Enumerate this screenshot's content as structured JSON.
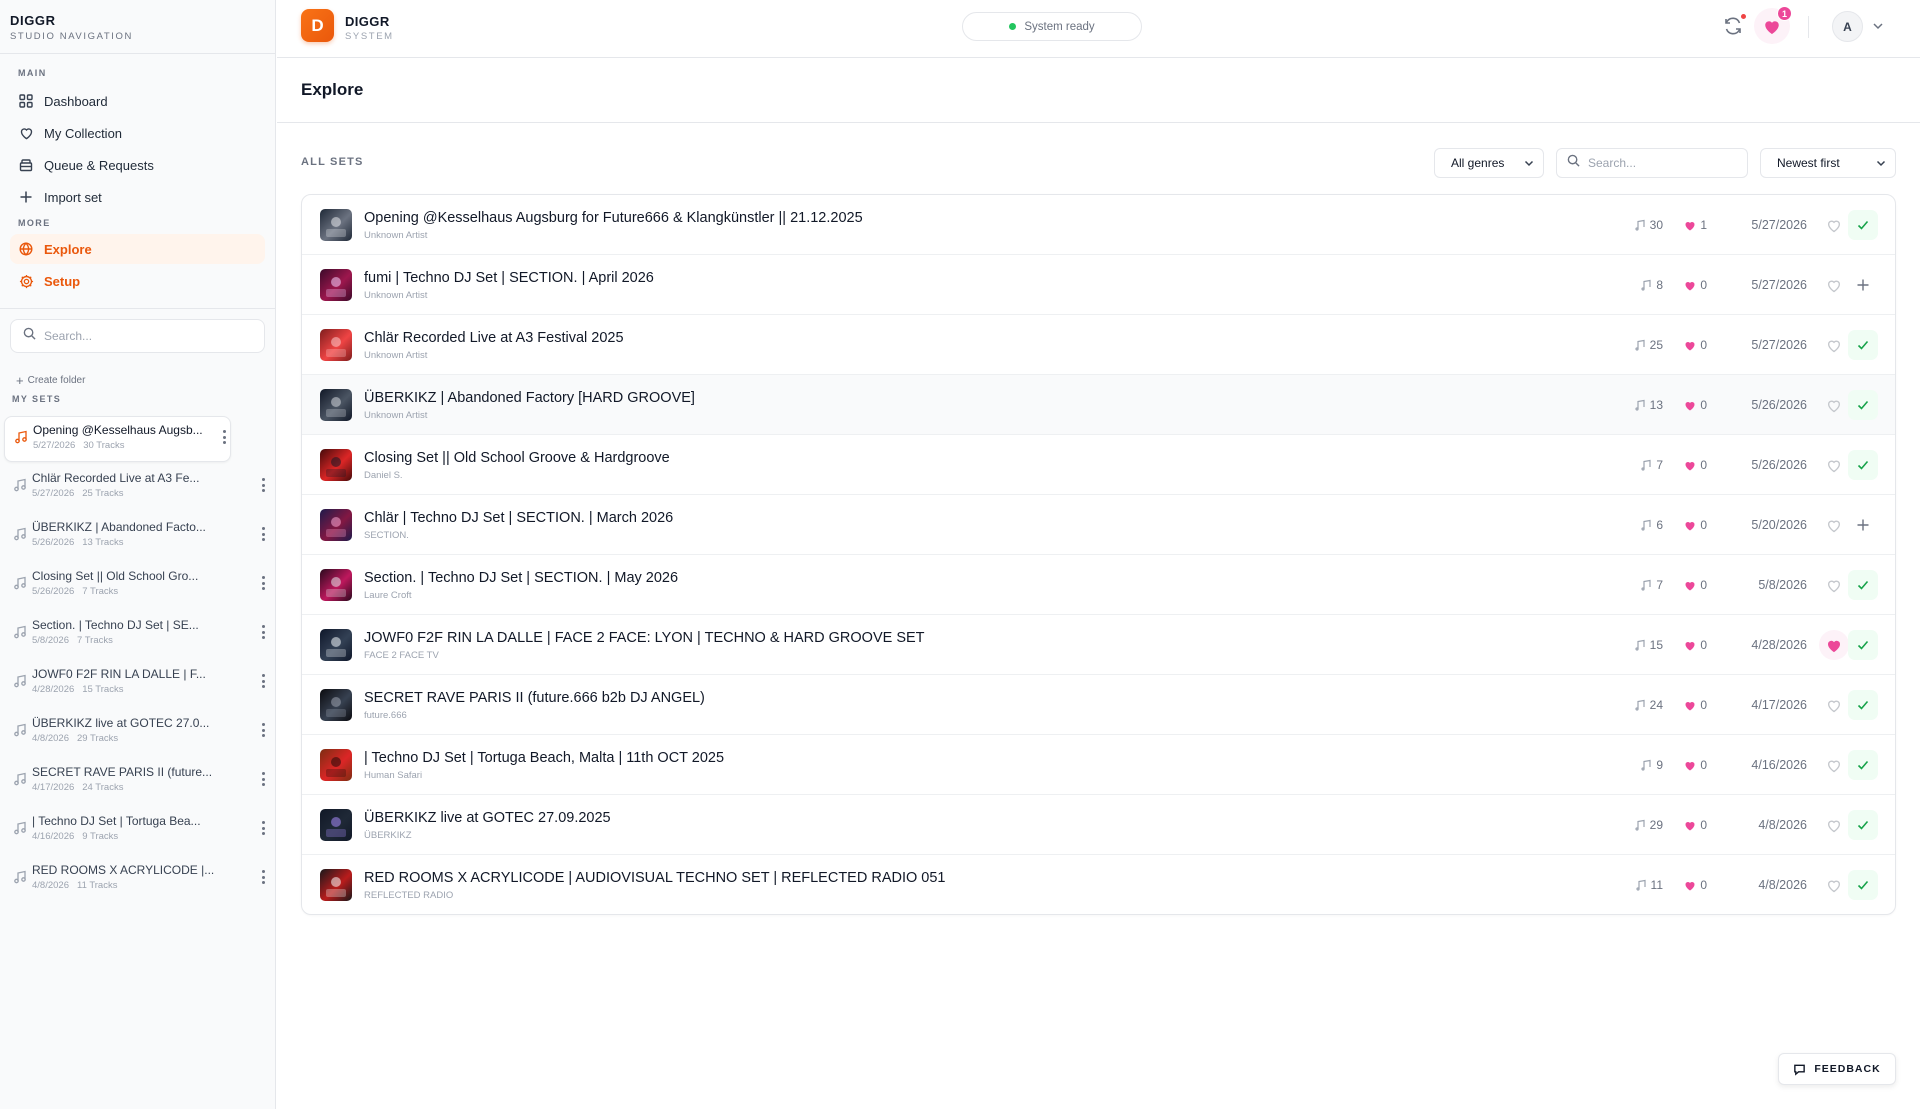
{
  "sidebar": {
    "brand_title": "DIGGR",
    "brand_subtitle": "STUDIO NAVIGATION",
    "main_label": "MAIN",
    "more_label": "MORE",
    "nav_main": [
      {
        "label": "Dashboard",
        "icon": "grid-icon"
      },
      {
        "label": "My Collection",
        "icon": "heart-outline-icon"
      },
      {
        "label": "Queue & Requests",
        "icon": "archive-icon"
      },
      {
        "label": "Import set",
        "icon": "plus-icon"
      }
    ],
    "nav_more": [
      {
        "label": "Explore",
        "icon": "globe-icon",
        "active": true
      },
      {
        "label": "Setup",
        "icon": "gear-icon"
      }
    ],
    "search_placeholder": "Search...",
    "create_folder": "Create folder",
    "my_sets_label": "MY SETS",
    "sets": [
      {
        "title": "Opening @Kesselhaus Augsb...",
        "date": "5/27/2026",
        "tracks": "30 Tracks",
        "active": true
      },
      {
        "title": "Chlär Recorded Live at A3 Fe...",
        "date": "5/27/2026",
        "tracks": "25 Tracks"
      },
      {
        "title": "ÜBERKIKZ | Abandoned Facto...",
        "date": "5/26/2026",
        "tracks": "13 Tracks"
      },
      {
        "title": "Closing Set || Old School Gro...",
        "date": "5/26/2026",
        "tracks": "7 Tracks"
      },
      {
        "title": "Section. | Techno DJ Set | SE...",
        "date": "5/8/2026",
        "tracks": "7 Tracks"
      },
      {
        "title": "JOWF0 F2F RIN LA DALLE | F...",
        "date": "4/28/2026",
        "tracks": "15 Tracks"
      },
      {
        "title": "ÜBERKIKZ live at GOTEC 27.0...",
        "date": "4/8/2026",
        "tracks": "29 Tracks"
      },
      {
        "title": "SECRET RAVE PARIS II (future...",
        "date": "4/17/2026",
        "tracks": "24 Tracks"
      },
      {
        "title": "| Techno DJ Set | Tortuga Bea...",
        "date": "4/16/2026",
        "tracks": "9 Tracks"
      },
      {
        "title": "RED ROOMS X ACRYLICODE |...",
        "date": "4/8/2026",
        "tracks": "11 Tracks"
      }
    ]
  },
  "header": {
    "logo_letter": "D",
    "brand_title": "DIGGR",
    "brand_subtitle": "SYSTEM",
    "status": "System ready",
    "status_color": "#22c55e",
    "favorites_badge": "1",
    "avatar_letter": "A"
  },
  "main": {
    "title": "Explore",
    "section_label": "ALL SETS",
    "genre_filter": "All genres",
    "search_placeholder": "Search...",
    "sort": "Newest first",
    "rows": [
      {
        "title": "Opening @Kesselhaus Augsburg for Future666 & Klangkünstler || 21.12.2025",
        "artist": "Unknown Artist",
        "tracks": "30",
        "likes": "1",
        "date": "5/27/2026",
        "favorited": false,
        "added": true
      },
      {
        "title": "fumi | Techno DJ Set | SECTION. | April 2026",
        "artist": "Unknown Artist",
        "tracks": "8",
        "likes": "0",
        "date": "5/27/2026",
        "favorited": false,
        "added": false
      },
      {
        "title": "Chlär Recorded Live at A3 Festival 2025",
        "artist": "Unknown Artist",
        "tracks": "25",
        "likes": "0",
        "date": "5/27/2026",
        "favorited": false,
        "added": true
      },
      {
        "title": "ÜBERKIKZ | Abandoned Factory [HARD GROOVE]",
        "artist": "Unknown Artist",
        "tracks": "13",
        "likes": "0",
        "date": "5/26/2026",
        "favorited": false,
        "added": true
      },
      {
        "title": "Closing Set || Old School Groove & Hardgroove",
        "artist": "Daniel S.",
        "tracks": "7",
        "likes": "0",
        "date": "5/26/2026",
        "favorited": false,
        "added": true
      },
      {
        "title": "Chlär | Techno DJ Set | SECTION. | March 2026",
        "artist": "SECTION.",
        "tracks": "6",
        "likes": "0",
        "date": "5/20/2026",
        "favorited": false,
        "added": false
      },
      {
        "title": "Section. | Techno DJ Set | SECTION. | May 2026",
        "artist": "Laure Croft",
        "tracks": "7",
        "likes": "0",
        "date": "5/8/2026",
        "favorited": false,
        "added": true
      },
      {
        "title": "JOWF0 F2F RIN LA DALLE | FACE 2 FACE: LYON | TECHNO & HARD GROOVE SET",
        "artist": "FACE 2 FACE TV",
        "tracks": "15",
        "likes": "0",
        "date": "4/28/2026",
        "favorited": true,
        "added": true
      },
      {
        "title": "SECRET RAVE PARIS II (future.666 b2b DJ ANGEL)",
        "artist": "future.666",
        "tracks": "24",
        "likes": "0",
        "date": "4/17/2026",
        "favorited": false,
        "added": true
      },
      {
        "title": "| Techno DJ Set | Tortuga Beach, Malta | 11th OCT 2025",
        "artist": "Human Safari",
        "tracks": "9",
        "likes": "0",
        "date": "4/16/2026",
        "favorited": false,
        "added": true
      },
      {
        "title": "ÜBERKIKZ live at GOTEC 27.09.2025",
        "artist": "ÜBERKIKZ",
        "tracks": "29",
        "likes": "0",
        "date": "4/8/2026",
        "favorited": false,
        "added": true
      },
      {
        "title": "RED ROOMS X ACRYLICODE | AUDIOVISUAL TECHNO SET | REFLECTED RADIO 051",
        "artist": "REFLECTED RADIO",
        "tracks": "11",
        "likes": "0",
        "date": "4/8/2026",
        "favorited": false,
        "added": true
      }
    ]
  },
  "feedback_label": "FEEDBACK",
  "colors": {
    "accent": "#ea580c",
    "like": "#ec4899",
    "added": "#16a34a"
  }
}
